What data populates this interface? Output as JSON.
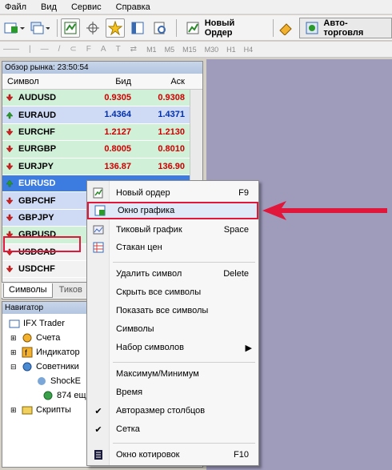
{
  "menubar": [
    "Файл",
    "Вид",
    "Сервис",
    "Справка"
  ],
  "toolbar": {
    "new_order": "Новый Ордер",
    "auto_trading": "Авто-торговля"
  },
  "timeframes": [
    "M1",
    "M5",
    "M15",
    "M30",
    "H1",
    "H4"
  ],
  "market_watch": {
    "title": "Обзор рынка: 23:50:54",
    "columns": [
      "Символ",
      "Бид",
      "Аск"
    ],
    "rows": [
      {
        "symbol": "AUDUSD",
        "bid": "0.9305",
        "ask": "0.9308"
      },
      {
        "symbol": "EURAUD",
        "bid": "1.4364",
        "ask": "1.4371"
      },
      {
        "symbol": "EURCHF",
        "bid": "1.2127",
        "ask": "1.2130"
      },
      {
        "symbol": "EURGBP",
        "bid": "0.8005",
        "ask": "0.8010"
      },
      {
        "symbol": "EURJPY",
        "bid": "136.87",
        "ask": "136.90"
      },
      {
        "symbol": "EURUSD",
        "bid": "",
        "ask": ""
      },
      {
        "symbol": "GBPCHF",
        "bid": "",
        "ask": ""
      },
      {
        "symbol": "GBPJPY",
        "bid": "",
        "ask": ""
      },
      {
        "symbol": "GBPUSD",
        "bid": "",
        "ask": ""
      },
      {
        "symbol": "USDCAD",
        "bid": "",
        "ask": ""
      },
      {
        "symbol": "USDCHF",
        "bid": "",
        "ask": ""
      },
      {
        "symbol": "USDJPY",
        "bid": "",
        "ask": ""
      }
    ],
    "tabs": [
      "Символы",
      "Тиков"
    ]
  },
  "navigator": {
    "title": "Навигатор",
    "items": [
      "IFX Trader",
      "Счета",
      "Индикатор",
      "Советники",
      "ShockE",
      "874 ещ",
      "Скрипты"
    ]
  },
  "context_menu": {
    "items": [
      {
        "label": "Новый ордер",
        "key": "F9"
      },
      {
        "label": "Окно графика",
        "key": ""
      },
      {
        "label": "Тиковый график",
        "key": "Space"
      },
      {
        "label": "Стакан цен",
        "key": ""
      },
      {
        "label": "Удалить символ",
        "key": "Delete"
      },
      {
        "label": "Скрыть все символы",
        "key": ""
      },
      {
        "label": "Показать все символы",
        "key": ""
      },
      {
        "label": "Символы",
        "key": ""
      },
      {
        "label": "Набор символов",
        "key": ""
      },
      {
        "label": "Максимум/Минимум",
        "key": ""
      },
      {
        "label": "Время",
        "key": ""
      },
      {
        "label": "Авторазмер столбцов",
        "key": ""
      },
      {
        "label": "Сетка",
        "key": ""
      },
      {
        "label": "Окно котировок",
        "key": "F10"
      }
    ]
  },
  "colors": {
    "highlight_red": "#e0163a",
    "selected_blue": "#3c7be0",
    "chart_bg": "#9e9bbb"
  }
}
